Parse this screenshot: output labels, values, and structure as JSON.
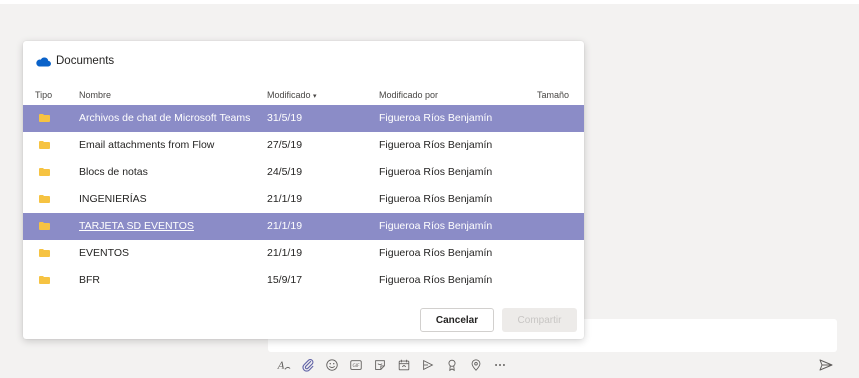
{
  "dialog": {
    "title": "Documents",
    "columns": {
      "type": "Tipo",
      "name": "Nombre",
      "modified": "Modificado",
      "modified_by": "Modificado por",
      "size": "Tamaño"
    },
    "rows": [
      {
        "name": "Archivos de chat de Microsoft Teams",
        "modified": "31/5/19",
        "modified_by": "Figueroa Ríos Benjamín",
        "selected": true
      },
      {
        "name": "Email attachments from Flow",
        "modified": "27/5/19",
        "modified_by": "Figueroa Ríos Benjamín",
        "selected": false
      },
      {
        "name": "Blocs de notas",
        "modified": "24/5/19",
        "modified_by": "Figueroa Ríos Benjamín",
        "selected": false
      },
      {
        "name": "INGENIERÍAS",
        "modified": "21/1/19",
        "modified_by": "Figueroa Ríos Benjamín",
        "selected": false
      },
      {
        "name": "TARJETA SD EVENTOS",
        "modified": "21/1/19",
        "modified_by": "Figueroa Ríos Benjamín",
        "selected": true
      },
      {
        "name": "EVENTOS",
        "modified": "21/1/19",
        "modified_by": "Figueroa Ríos Benjamín",
        "selected": false
      },
      {
        "name": "BFR",
        "modified": "15/9/17",
        "modified_by": "Figueroa Ríos Benjamín",
        "selected": false
      }
    ],
    "cancel_label": "Cancelar",
    "share_label": "Compartir"
  },
  "toolbar": {
    "icons": [
      "format-icon",
      "attach-icon",
      "emoji-icon",
      "gif-icon",
      "sticker-icon",
      "meeting-icon",
      "stream-icon",
      "praise-icon",
      "location-icon",
      "more-icon"
    ],
    "send_icon": "send-icon"
  },
  "colors": {
    "selected_row": "#8b8cc7",
    "folder": "#f6c342",
    "accent": "#6264a7",
    "onedrive": "#0a62c9"
  }
}
